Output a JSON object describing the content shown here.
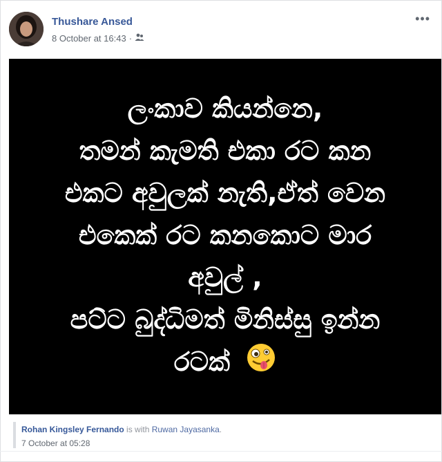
{
  "post": {
    "author": "Thushare Ansed",
    "timestamp": "8 October at 16:43",
    "separator": "·",
    "audience_icon": "friends-icon",
    "more_label": "•••"
  },
  "image_text": {
    "lines": [
      "ලංකාව කියන්නෙ,",
      "තමන් කැමති එකා රට කන",
      "එකට අවුලක් නැති,ඒත් වෙන",
      "එකෙක් රට කනකොට මාර",
      "අවුල් ,",
      "පට්ට බුද්ධිමත් මිනිස්සු ඉන්න",
      "රටක්"
    ],
    "emoji": "zany-face-emoji"
  },
  "shared": {
    "name": "Rohan Kingsley Fernando",
    "with_text": " is with ",
    "tagged": "Ruwan Jayasanka",
    "end": ".",
    "timestamp": "7 October at 05:28"
  },
  "colors": {
    "link": "#385898",
    "meta": "#606770",
    "image_bg": "#000000",
    "image_text": "#ffffff"
  }
}
